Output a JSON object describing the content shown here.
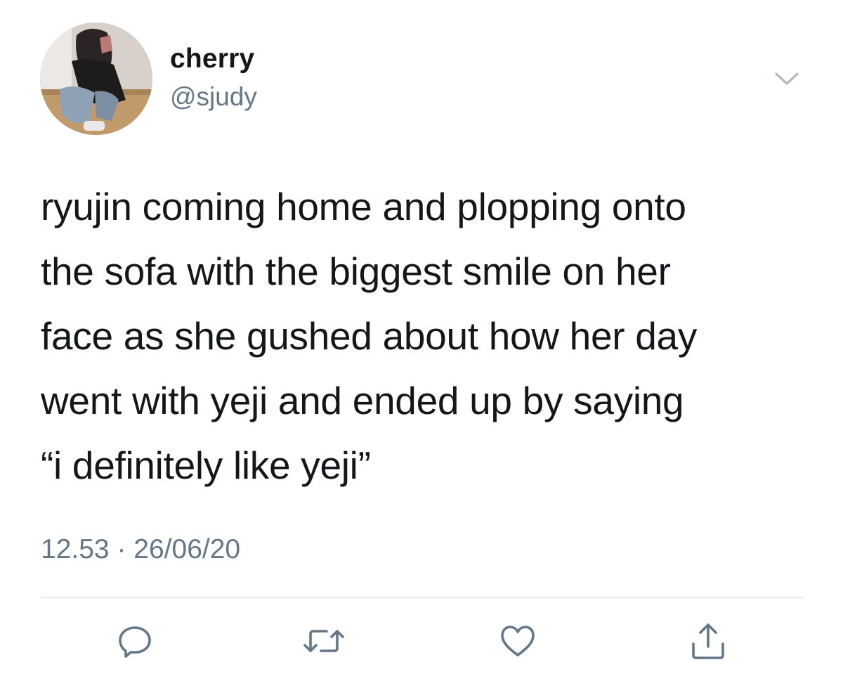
{
  "tweet": {
    "display_name": "cherry",
    "handle": "@sjudy",
    "text_lines": [
      "ryujin coming home and plopping onto",
      "the sofa with the biggest smile on her",
      "face as she gushed about how her day",
      "went with yeji and ended up by saying",
      "“i definitely like yeji”"
    ],
    "time": "12.53",
    "separator": "·",
    "date": "26/06/20"
  },
  "icons": {
    "more": "chevron-down-icon",
    "reply": "reply-bubble-icon",
    "retweet": "retweet-icon",
    "like": "heart-icon",
    "share": "share-icon"
  },
  "colors": {
    "text": "#14171a",
    "secondary": "#657786",
    "divider": "#e1e8ed",
    "icon": "#657786"
  }
}
